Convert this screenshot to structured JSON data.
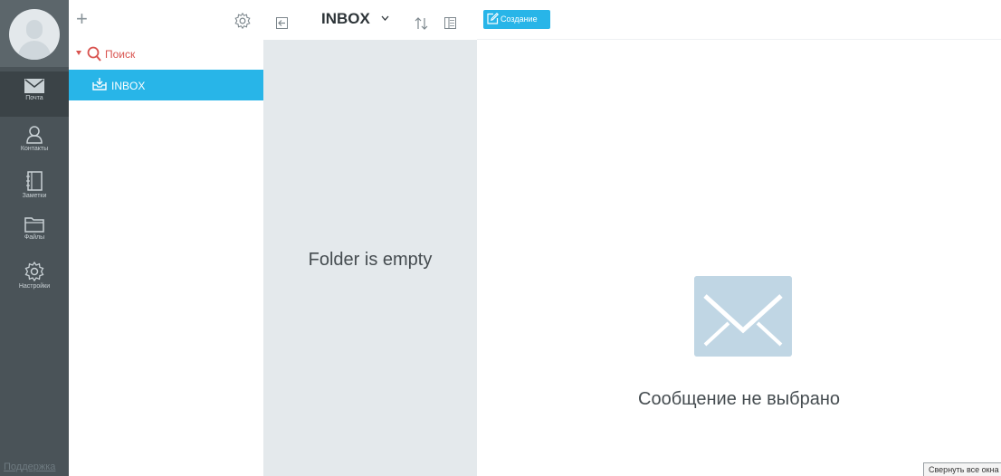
{
  "nav": {
    "items": [
      {
        "label": "Почта",
        "icon": "mail-icon"
      },
      {
        "label": "Контакты",
        "icon": "person-icon"
      },
      {
        "label": "Заметки",
        "icon": "notebook-icon"
      },
      {
        "label": "Файлы",
        "icon": "folder-icon"
      },
      {
        "label": "Настройки",
        "icon": "gear-icon"
      }
    ],
    "support": "Поддержка"
  },
  "folders": {
    "add": "+",
    "search_label": "Поиск",
    "inbox_label": "INBOX"
  },
  "list": {
    "title": "INBOX",
    "empty": "Folder is empty"
  },
  "preview": {
    "compose_label": "Создание",
    "no_message": "Сообщение не выбрано",
    "collapse_label": "Свернуть все окна"
  },
  "colors": {
    "accent": "#28b5e8",
    "rail": "#4a5358",
    "search": "#d9534f",
    "list_bg": "#e4e9ec"
  }
}
